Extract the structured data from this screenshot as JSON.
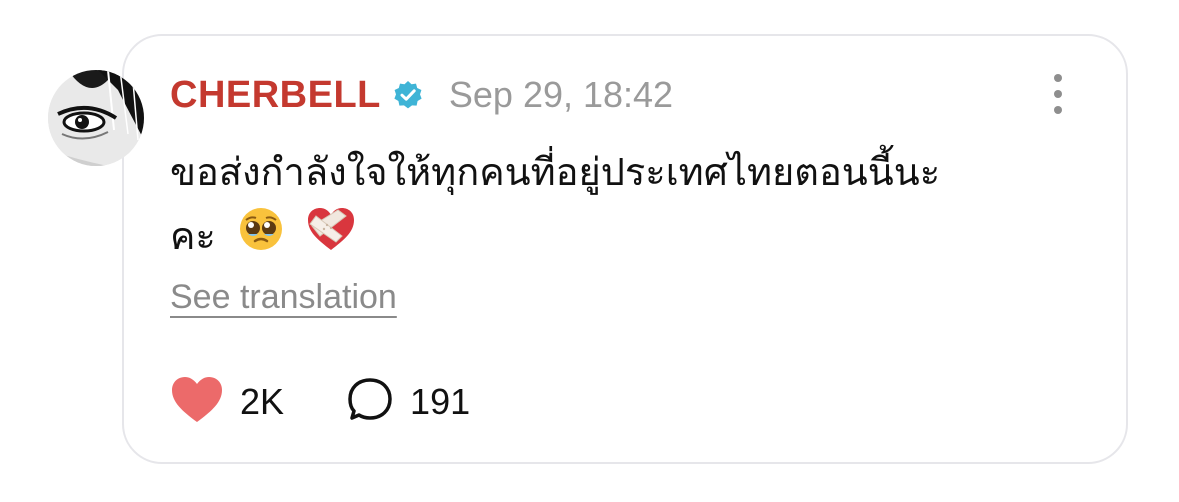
{
  "post": {
    "username": "CHERBELL",
    "verified": true,
    "timestamp": "Sep 29, 18:42",
    "text_line_1": "ขอส่งกำลังใจให้ทุกคนที่อยู่ประเทศไทยตอนนี้นะ",
    "text_line_2": "คะ",
    "emojis": [
      "pleading-face-icon",
      "mending-heart-icon"
    ],
    "translate_label": "See translation",
    "likes": "2K",
    "comments": "191"
  },
  "icons": {
    "more": "more-vertical-icon",
    "like": "heart-icon",
    "comment": "comment-bubble-icon",
    "verified": "verified-badge-icon"
  },
  "colors": {
    "username": "#c4392f",
    "verified_badge": "#3fb4d6",
    "like_heart": "#ec6a6a",
    "timestamp": "#9a9a9a",
    "card_border": "#e6e6ea"
  }
}
